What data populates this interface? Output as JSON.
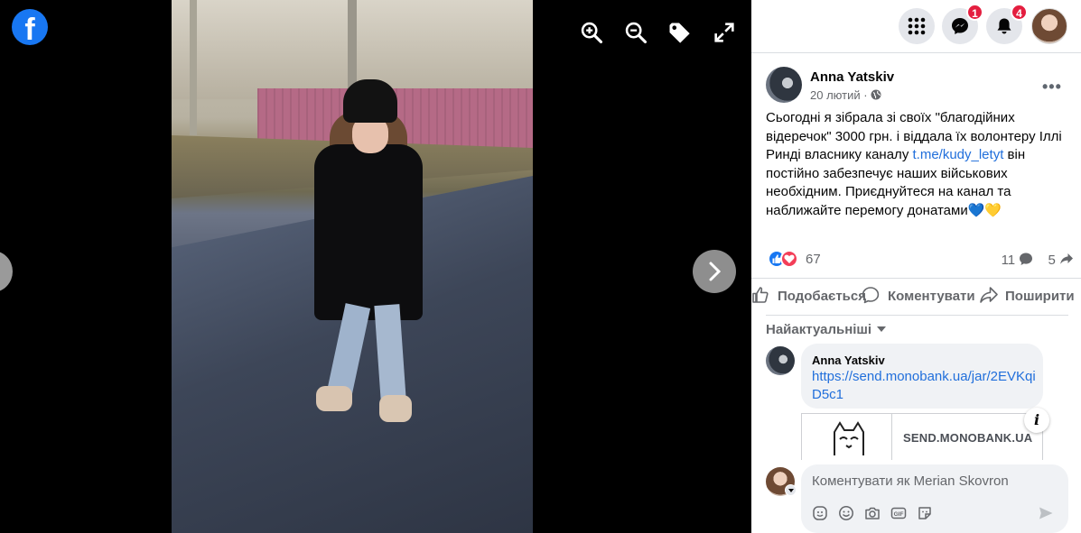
{
  "viewer": {
    "logo_letter": "f",
    "tools": [
      "zoom-in-icon",
      "zoom-out-icon",
      "tag-icon",
      "fullscreen-icon"
    ]
  },
  "topbar": {
    "messenger_badge": "1",
    "notifications_badge": "4"
  },
  "post": {
    "author": "Anna Yatskiv",
    "date": "20 лютий",
    "privacy_separator": "·",
    "text_before_link": "Сьогодні я зібрала зі своїх \"благодійних відеречок\" 3000 грн. і віддала їх волонтеру Іллі Ринді власнику каналу ",
    "link_text": "t.me/kudy_letyt",
    "text_after_link": " він постійно забезпечує наших військових необхідним. Приєднуйтеся на канал та наближайте перемогу донатами💙💛",
    "reaction_count": "67",
    "comment_count": "11",
    "share_count": "5"
  },
  "actions": {
    "like": "Подобається",
    "comment": "Коментувати",
    "share": "Поширити"
  },
  "comments": {
    "sort_label": "Найактуальніші",
    "items": [
      {
        "author": "Anna Yatskiv",
        "link": "https://send.monobank.ua/jar/2EVKqiD5c1",
        "preview_domain": "SEND.MONOBANK.UA"
      }
    ]
  },
  "composer": {
    "placeholder": "Коментувати як Merian Skovron"
  },
  "colors": {
    "brand": "#1877f2",
    "badge": "#e41e3f",
    "link": "#216fdb"
  }
}
